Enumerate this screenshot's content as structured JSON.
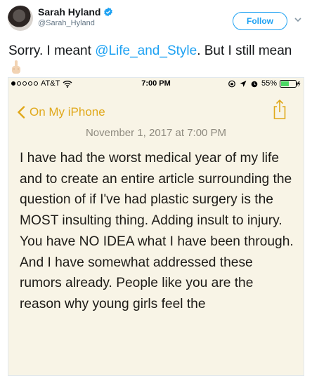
{
  "tweet": {
    "author": {
      "display_name": "Sarah Hyland",
      "handle": "@Sarah_Hyland",
      "verified_icon": "verified-badge-icon",
      "avatar_icon": "avatar-photo"
    },
    "follow_label": "Follow",
    "menu_icon": "chevron-down-icon",
    "text": {
      "before": "Sorry. I meant ",
      "mention": "@Life_and_Style",
      "after": ". But I still mean",
      "emoji": "middle-finger-emoji"
    },
    "colors": {
      "accent": "#1da1f2",
      "text": "#14171a",
      "secondary": "#657786"
    }
  },
  "phone": {
    "status_bar": {
      "carrier": "AT&T",
      "time": "7:00 PM",
      "battery": "55%",
      "battery_level": 0.55
    },
    "nav": {
      "back_label": "On My iPhone",
      "share_icon": "share-icon"
    },
    "note": {
      "date": "November 1, 2017 at 7:00 PM",
      "body": "I have had the worst medical year of my life and to create an entire article surrounding the question of if I've had plastic surgery is the MOST insulting thing. Adding insult to injury. You have NO IDEA what I have been through. And I have somewhat addressed these rumors already. People like you are the reason why young girls feel the"
    },
    "colors": {
      "background": "#f8f4e6",
      "accent": "#e0a81a"
    }
  }
}
